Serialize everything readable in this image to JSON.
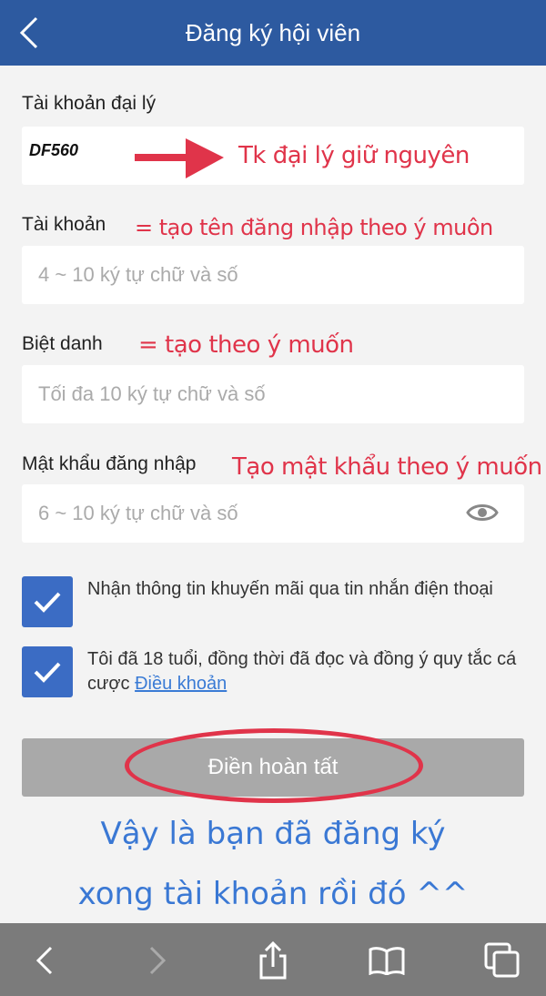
{
  "header": {
    "title": "Đăng ký hội viên"
  },
  "form": {
    "agent_label": "Tài khoản đại lý",
    "agent_value": "DF560",
    "agent_note": "Tk đại lý giữ nguyên",
    "account_label": "Tài khoản",
    "account_note": "= tạo tên đăng nhập theo ý muôn",
    "account_placeholder": "4 ~ 10 ký tự chữ và số",
    "nickname_label": "Biệt danh",
    "nickname_note": "= tạo theo ý muốn",
    "nickname_placeholder": "Tối đa 10 ký tự chữ và số",
    "password_label": "Mật khẩu đăng nhập",
    "password_note": "Tạo mật khẩu theo ý muốn",
    "password_placeholder": "6 ~ 10 ký tự chữ và số",
    "promo_checkbox_text": "Nhận thông tin khuyến mãi qua tin nhắn điện thoại",
    "terms_checkbox_text": "Tôi đã 18 tuổi, đồng thời đã đọc và đồng ý quy tắc cá cược",
    "terms_link": "Điều khoản",
    "submit_label": "Điền hoàn tất"
  },
  "annotation": {
    "done_line1": "Vậy là bạn đã đăng ký",
    "done_line2": "xong tài khoản rồi đó ^^"
  },
  "colors": {
    "header": "#2d5aa0",
    "checkbox": "#3b6cc4",
    "note_red": "#e0344a",
    "note_blue": "#3a78d4",
    "toolbar": "#7b7b7b"
  },
  "icons": [
    "chevron-left-icon",
    "eye-icon",
    "check-icon",
    "back-arrow-icon",
    "forward-arrow-icon",
    "share-icon",
    "bookmarks-icon",
    "tabs-icon"
  ]
}
